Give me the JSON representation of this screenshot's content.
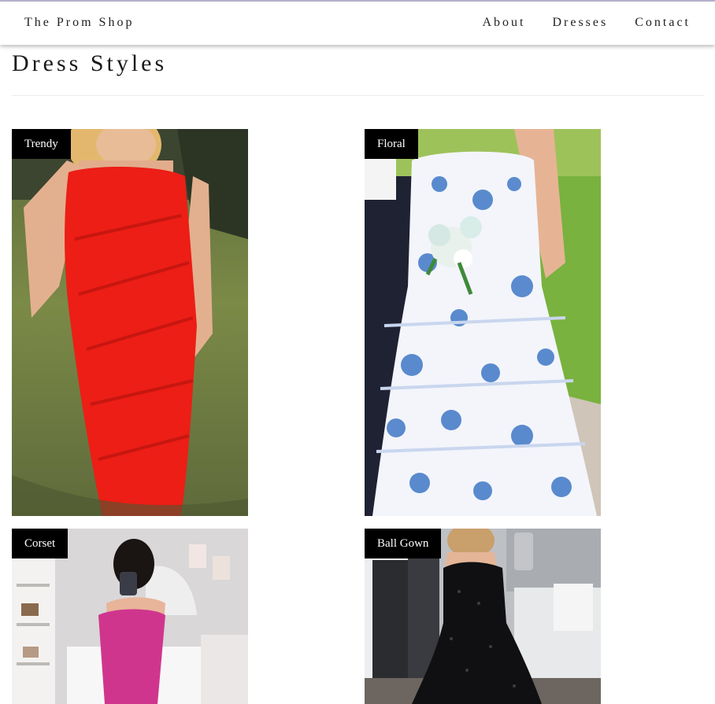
{
  "nav": {
    "brand": "The Prom Shop",
    "links": [
      "About",
      "Dresses",
      "Contact"
    ]
  },
  "page": {
    "title": "Dress Styles"
  },
  "cards": [
    {
      "label": "Trendy",
      "dress_color": "#ec1e16"
    },
    {
      "label": "Floral",
      "dress_color": "#3f78c6"
    },
    {
      "label": "Corset",
      "dress_color": "#d0358e"
    },
    {
      "label": "Ball Gown",
      "dress_color": "#101012"
    }
  ]
}
